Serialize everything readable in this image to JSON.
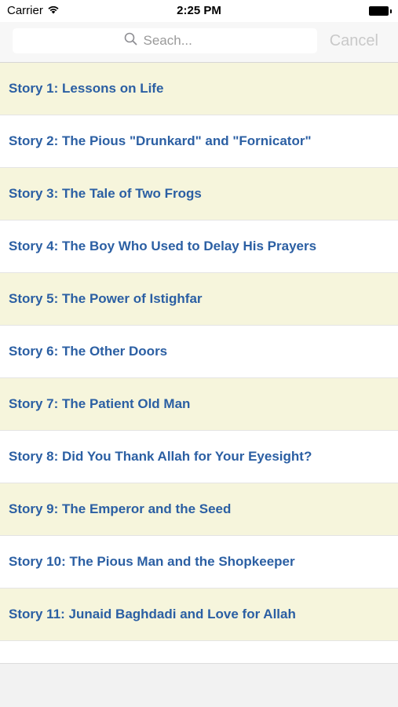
{
  "status_bar": {
    "carrier": "Carrier",
    "time": "2:25 PM",
    "wifi_icon": "wifi-icon",
    "battery_icon": "battery-icon"
  },
  "search": {
    "placeholder": "Seach...",
    "value": "",
    "cancel_label": "Cancel",
    "icon": "search-icon"
  },
  "colors": {
    "title_text": "#2b5fa3",
    "odd_row_background": "#f6f5dc",
    "even_row_background": "#ffffff",
    "cancel_disabled": "#c9c9c9"
  },
  "stories": [
    {
      "title": "Story 1: Lessons on Life"
    },
    {
      "title": "Story 2: The Pious \"Drunkard\" and \"Fornicator\""
    },
    {
      "title": "Story 3: The Tale of Two Frogs"
    },
    {
      "title": "Story 4: The Boy Who Used to Delay His Prayers"
    },
    {
      "title": "Story 5: The Power of Istighfar"
    },
    {
      "title": "Story 6: The Other Doors"
    },
    {
      "title": "Story 7: The Patient Old Man"
    },
    {
      "title": "Story 8: Did You Thank Allah for Your Eyesight?"
    },
    {
      "title": "Story 9: The Emperor and the Seed"
    },
    {
      "title": "Story 10: The Pious Man and the Shopkeeper"
    },
    {
      "title": "Story 11: Junaid Baghdadi and Love for Allah"
    }
  ]
}
